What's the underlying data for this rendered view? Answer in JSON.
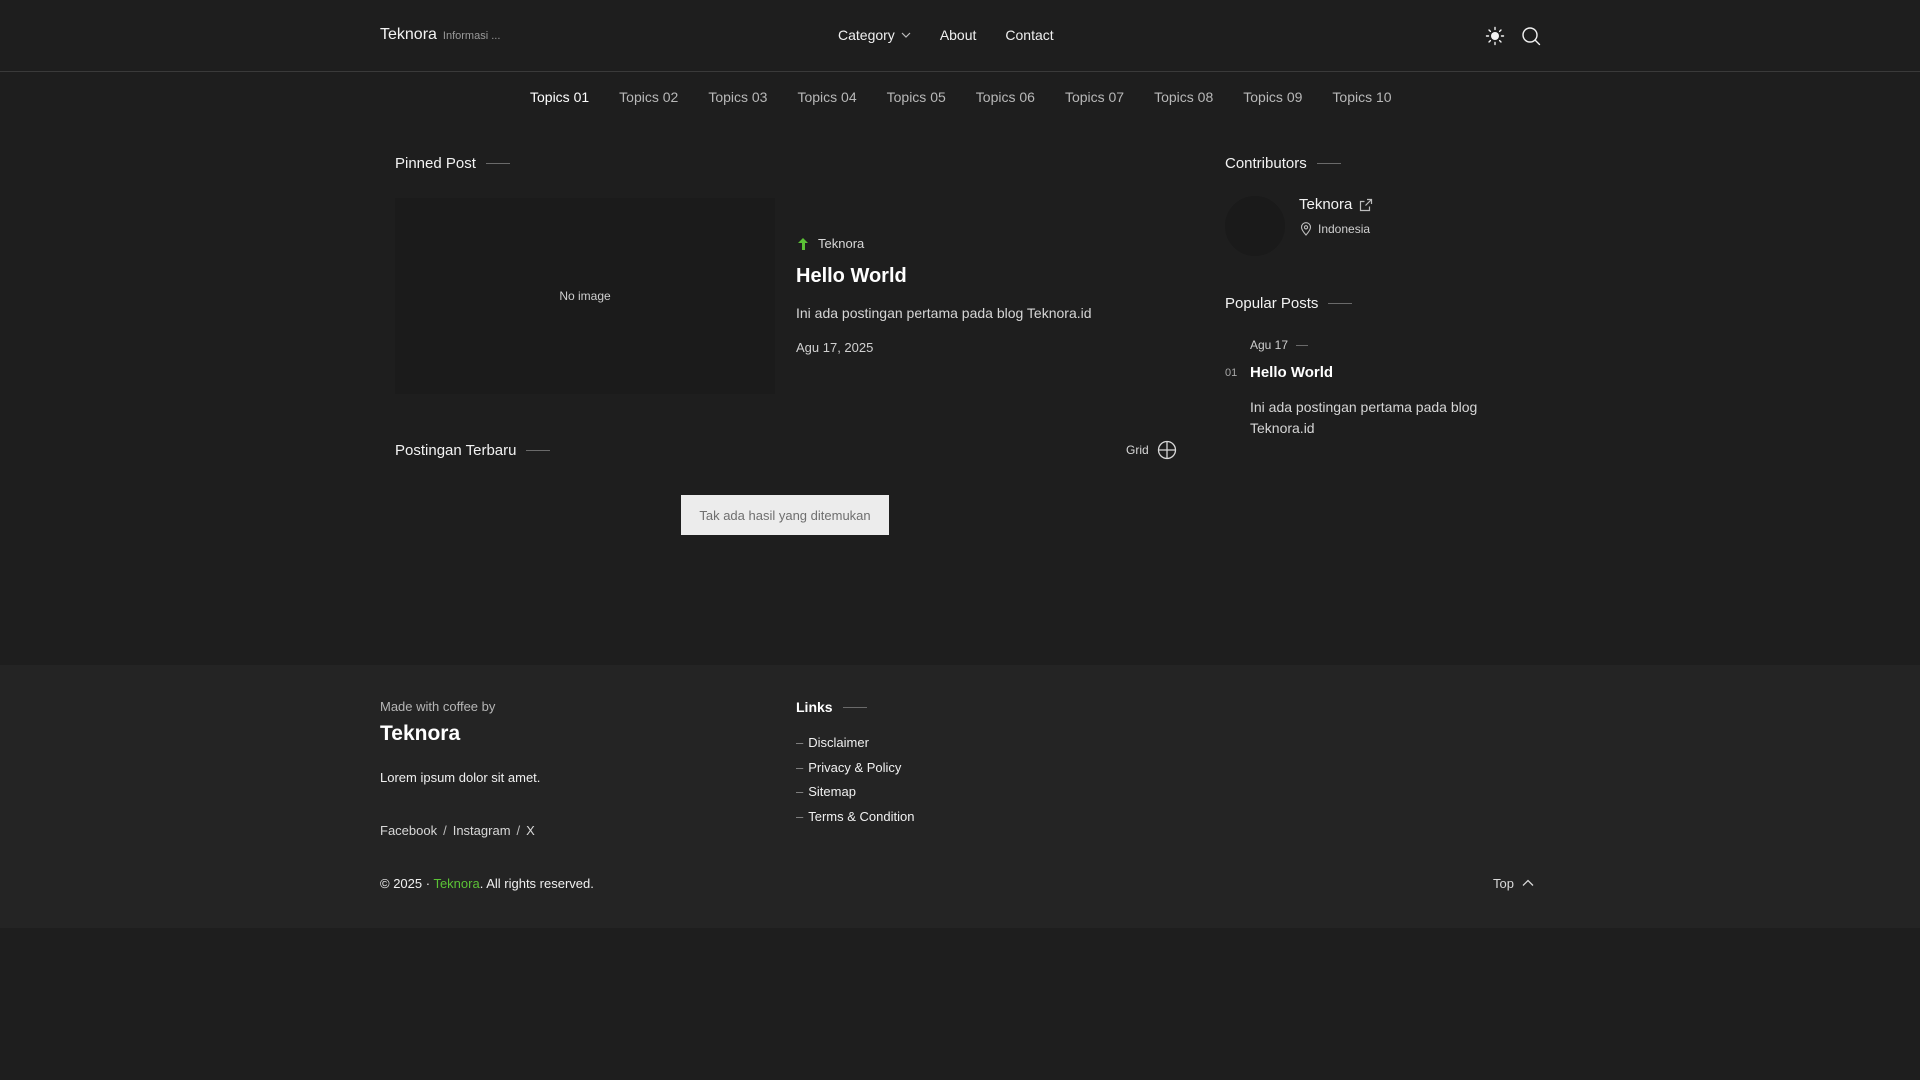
{
  "header": {
    "brand": "Teknora",
    "tagline": "Informasi ...",
    "nav": {
      "category": "Category",
      "about": "About",
      "contact": "Contact"
    }
  },
  "topics": [
    "Topics 01",
    "Topics 02",
    "Topics 03",
    "Topics 04",
    "Topics 05",
    "Topics 06",
    "Topics 07",
    "Topics 08",
    "Topics 09",
    "Topics 10"
  ],
  "pinned": {
    "section_title": "Pinned Post",
    "image_placeholder": "No image",
    "author": "Teknora",
    "title": "Hello World",
    "excerpt": "Ini ada postingan pertama pada blog Teknora.id",
    "date": "Agu 17, 2025"
  },
  "latest": {
    "section_title": "Postingan Terbaru",
    "view_toggle": "Grid",
    "empty_message": "Tak ada hasil yang ditemukan"
  },
  "sidebar": {
    "contributors_title": "Contributors",
    "contributor": {
      "name": "Teknora",
      "location": "Indonesia"
    },
    "popular_title": "Popular Posts",
    "popular": {
      "date": "Agu 17",
      "number": "01",
      "title": "Hello World",
      "excerpt": "Ini ada postingan pertama pada blog Teknora.id"
    }
  },
  "footer": {
    "made_by": "Made with coffee by",
    "brand": "Teknora",
    "description": "Lorem ipsum dolor sit amet.",
    "socials": [
      "Facebook",
      "Instagram",
      "X"
    ],
    "social_separator": "/",
    "links_title": "Links",
    "links": [
      "Disclaimer",
      "Privacy & Policy",
      "Sitemap",
      "Terms & Condition"
    ],
    "link_dash": "–",
    "copyright_prefix": "© 2025 ·",
    "copyright_brand": "Teknora",
    "copyright_suffix": ". All rights reserved.",
    "top_label": "Top"
  },
  "colors": {
    "background": "#1e1e1e",
    "footer": "#242424",
    "accent": "#5bc236"
  }
}
